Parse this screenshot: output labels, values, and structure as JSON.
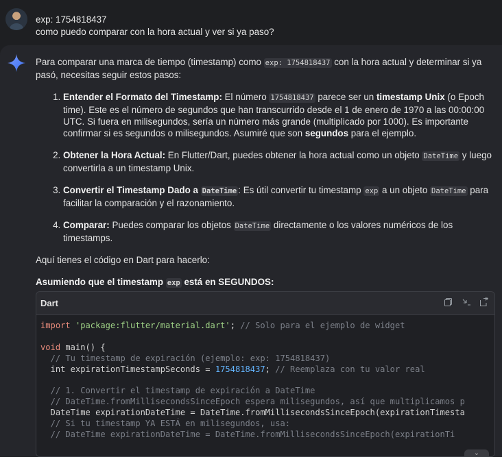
{
  "user": {
    "line1": "exp: 1754818437",
    "line2": "como puedo comparar con la hora actual y ver si ya paso?"
  },
  "answer": {
    "intro_a": "Para comparar una marca de tiempo (timestamp) como ",
    "intro_code": "exp: 1754818437",
    "intro_b": " con la hora actual y determinar si ya pasó, necesitas seguir estos pasos:",
    "steps": [
      {
        "title": "Entender el Formato del Timestamp:",
        "a": " El número ",
        "code": "1754818437",
        "b": " parece ser un ",
        "bold2": "timestamp Unix",
        "c": " (o Epoch time). Este es el número de segundos que han transcurrido desde el 1 de enero de 1970 a las 00:00:00 UTC. Si fuera en milisegundos, sería un número más grande (multiplicado por 1000). Es importante confirmar si es segundos o milisegundos. Asumiré que son ",
        "bold3": "segundos",
        "d": " para el ejemplo."
      },
      {
        "title": "Obtener la Hora Actual:",
        "a": " En Flutter/Dart, puedes obtener la hora actual como un objeto ",
        "code": "DateTime",
        "b": " y luego convertirla a un timestamp Unix."
      },
      {
        "title": "Convertir el Timestamp Dado a ",
        "title_code": "DateTime",
        "a": ": Es útil convertir tu timestamp ",
        "code": "exp",
        "b": " a un objeto ",
        "code2": "DateTime",
        "c": " para facilitar la comparación y el razonamiento."
      },
      {
        "title": "Comparar:",
        "a": " Puedes comparar los objetos ",
        "code": "DateTime",
        "b": " directamente o los valores numéricos de los timestamps."
      }
    ],
    "dart_line": "Aquí tienes el código en Dart para hacerlo:",
    "assume_a": "Asumiendo que el timestamp ",
    "assume_code": "exp",
    "assume_b": " está en SEGUNDOS:"
  },
  "code_block": {
    "language": "Dart",
    "tools": [
      "copy-icon",
      "wrap-icon",
      "expand-icon"
    ],
    "lines": [
      "import 'package:flutter/material.dart'; // Solo para el ejemplo de widget",
      "",
      "void main() {",
      "  // Tu timestamp de expiración (ejemplo: exp: 1754818437)",
      "  int expirationTimestampSeconds = 1754818437; // Reemplaza con tu valor real",
      "",
      "  // 1. Convertir el timestamp de expiración a DateTime",
      "  // DateTime.fromMillisecondsSinceEpoch espera milisegundos, así que multiplicamos p",
      "  DateTime expirationDateTime = DateTime.fromMillisecondsSinceEpoch(expirationTimesta",
      "  // Si tu timestamp YA ESTÁ en milisegundos, usa:",
      "  // DateTime expirationDateTime = DateTime.fromMillisecondsSinceEpoch(expirationTi"
    ]
  },
  "colors": {
    "accent_star": "#4f8df7",
    "keyword": "#e58a7a",
    "string": "#9fd286",
    "number": "#64b5ff",
    "comment": "#7c8089"
  }
}
